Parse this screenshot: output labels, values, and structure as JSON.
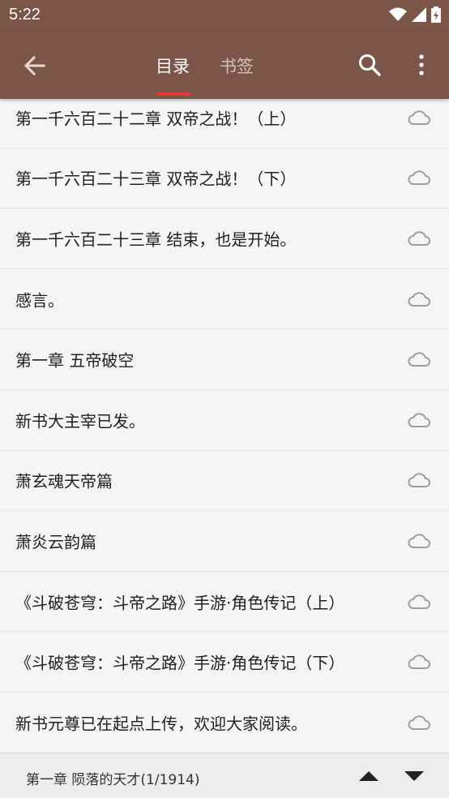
{
  "status_bar": {
    "time": "5:22"
  },
  "tabs": [
    {
      "label": "目录",
      "selected": true
    },
    {
      "label": "书签",
      "selected": false
    }
  ],
  "colors": {
    "appbar": "#7a5548",
    "tab_indicator": "#e53935"
  },
  "chapters": [
    {
      "title": "第一千六百二十二章 双帝之战！（上）",
      "icon": "cloud-icon"
    },
    {
      "title": "第一千六百二十三章 双帝之战！（下）",
      "icon": "cloud-icon"
    },
    {
      "title": "第一千六百二十三章 结束，也是开始。",
      "icon": "cloud-icon"
    },
    {
      "title": "感言。",
      "icon": "cloud-icon"
    },
    {
      "title": "第一章 五帝破空",
      "icon": "cloud-icon"
    },
    {
      "title": "新书大主宰已发。",
      "icon": "cloud-icon"
    },
    {
      "title": "萧玄魂天帝篇",
      "icon": "cloud-icon"
    },
    {
      "title": "萧炎云韵篇",
      "icon": "cloud-icon"
    },
    {
      "title": "《斗破苍穹：斗帝之路》手游·角色传记（上）",
      "icon": "cloud-icon"
    },
    {
      "title": "《斗破苍穹：斗帝之路》手游·角色传记（下）",
      "icon": "cloud-icon"
    },
    {
      "title": "新书元尊已在起点上传，欢迎大家阅读。",
      "icon": "cloud-icon"
    }
  ],
  "bottom_bar": {
    "current_chapter": "第一章 陨落的天才(1/1914)"
  }
}
